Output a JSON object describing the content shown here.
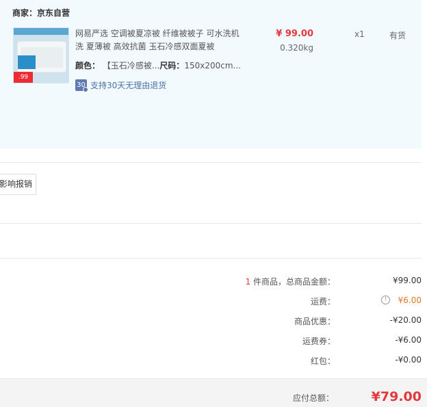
{
  "shop": {
    "title": "商家：京东自营"
  },
  "item": {
    "thumb_price": ".99",
    "name": "网易严选 空调被夏凉被 纤维被被子 可水洗机洗 夏薄被 高效抗菌 玉石冷感双面夏被",
    "color_label": "颜色：",
    "color_value": "【玉石冷感被...",
    "size_label": "尺码：",
    "size_value": "150x200cm...",
    "return_badge": "30",
    "return_text": "支持30天无理由退货",
    "price": "¥ 99.00",
    "weight": "0.320kg",
    "quantity": "x1",
    "stock": "有货"
  },
  "invoice": {
    "button_label": "影响报销"
  },
  "summary": {
    "count": "1",
    "goods_label": " 件商品，总商品金额：",
    "goods_value": "¥99.00",
    "shipping_label": "运费：",
    "shipping_value": "¥6.00",
    "discount_label": "商品优惠：",
    "discount_value": "-¥20.00",
    "coupon_label": "运费券：",
    "coupon_value": "-¥6.00",
    "redpacket_label": "红包：",
    "redpacket_value": "-¥0.00",
    "total_label": "应付总额：",
    "total_value": "¥79.00"
  },
  "colors": {
    "accent_red": "#e4393c",
    "shipping_orange": "#e87722",
    "shop_bg": "#f3fafe",
    "link_blue": "#4a73a6"
  }
}
